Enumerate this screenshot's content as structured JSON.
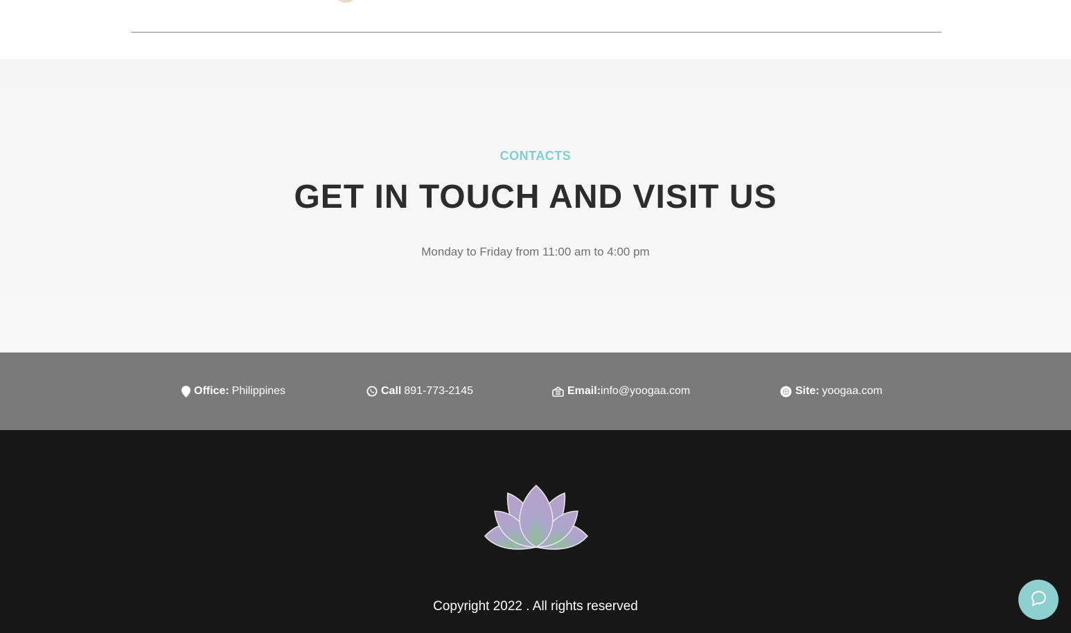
{
  "contacts": {
    "eyebrow": "CONTACTS",
    "heading": "GET IN TOUCH AND VISIT US",
    "hours": "Monday to Friday from 11:00 am to 4:00 pm"
  },
  "info_bar": {
    "office": {
      "icon": "map-pin-icon",
      "label": "Office:",
      "value": "Philippines"
    },
    "call": {
      "icon": "whatsapp-icon",
      "label": "Call",
      "value": "891-773-2145"
    },
    "email": {
      "icon": "envelope-icon",
      "label": "Email:",
      "value": "info@yoogaa.com"
    },
    "site": {
      "icon": "globe-icon",
      "label": "Site:",
      "value": "yoogaa.com"
    }
  },
  "footer": {
    "logo_icon": "lotus-logo-icon",
    "copyright": "Copyright 2022 . All rights reserved"
  },
  "chat": {
    "icon": "chat-bubble-icon"
  },
  "colors": {
    "accent": "#7ecfcf",
    "heading": "#2c2c2c",
    "info_bar_bg": "#7a7a7a",
    "footer_bg": "#171717",
    "chat_button": "#8ecfcf"
  }
}
